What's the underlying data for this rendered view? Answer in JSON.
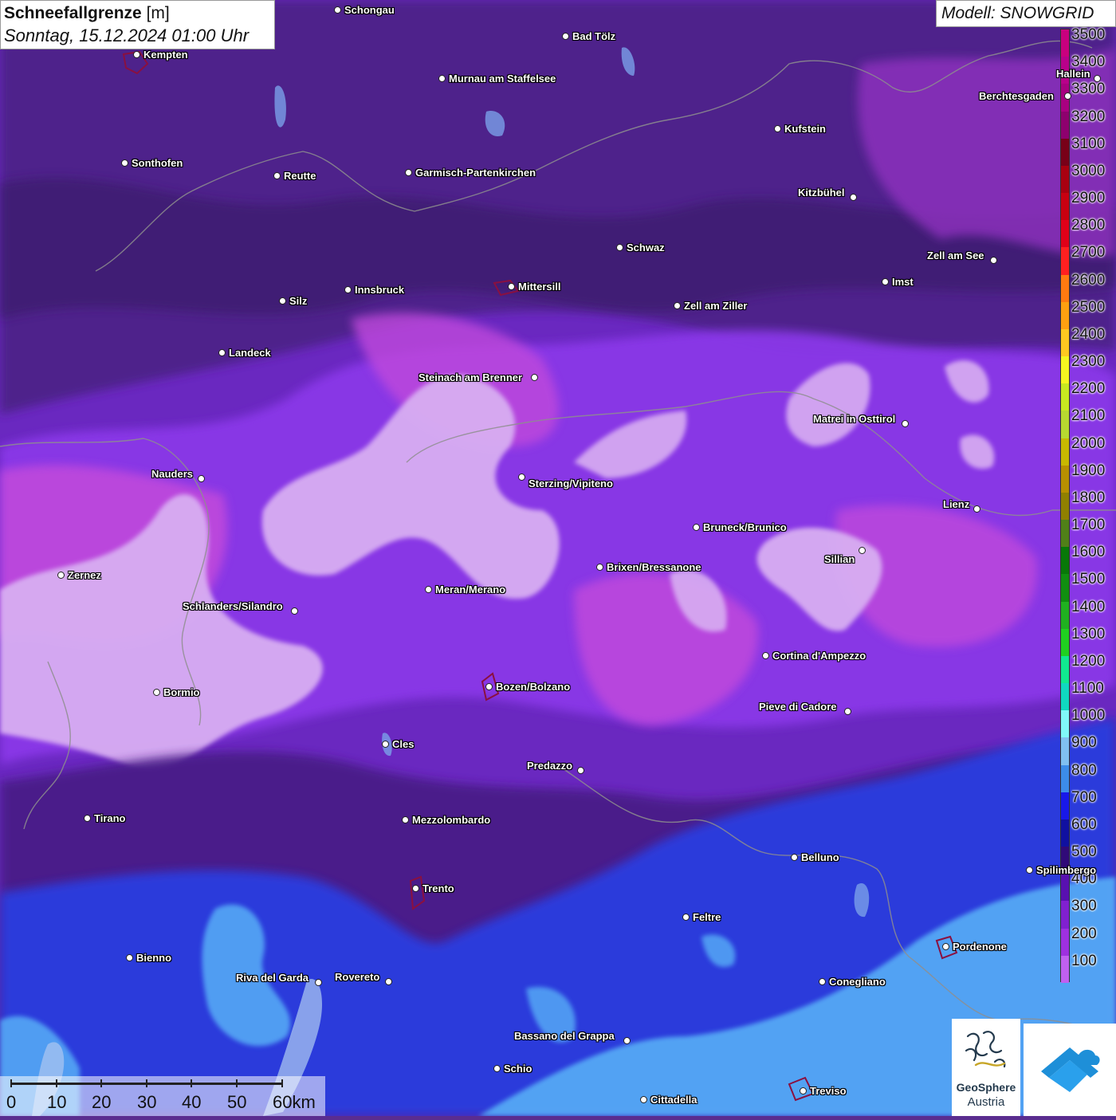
{
  "header": {
    "title": "Schneefallgrenze",
    "unit": "[m]",
    "datetime": "Sonntag, 15.12.2024 01:00 Uhr"
  },
  "model": {
    "label": "Modell: SNOWGRID"
  },
  "legend": {
    "values": [
      "3500",
      "3400",
      "3300",
      "3200",
      "3100",
      "3000",
      "2900",
      "2800",
      "2700",
      "2600",
      "2500",
      "2400",
      "2300",
      "2200",
      "2100",
      "2000",
      "1900",
      "1800",
      "1700",
      "1600",
      "1500",
      "1400",
      "1300",
      "1200",
      "1100",
      "1000",
      "900",
      "800",
      "700",
      "600",
      "500",
      "400",
      "300",
      "200",
      "100"
    ],
    "colors": [
      "#c8007e",
      "#b8008a",
      "#a80080",
      "#8e006e",
      "#780018",
      "#a80010",
      "#c80010",
      "#e00018",
      "#ff2020",
      "#ff7a10",
      "#ffa010",
      "#ffc820",
      "#f5f520",
      "#c8e820",
      "#b8d830",
      "#c8b800",
      "#b89000",
      "#908000",
      "#508018",
      "#087808",
      "#108e10",
      "#20b020",
      "#20d020",
      "#10e890",
      "#10d8c0",
      "#80f8f8",
      "#80c0f0",
      "#3c8ce8",
      "#1818e8",
      "#1010a0",
      "#300a78",
      "#5810b0",
      "#8020d0",
      "#9e30e0",
      "#c060f0"
    ]
  },
  "palette": {
    "light_blue": "#55a8f5",
    "blue": "#2a3ee0",
    "dark_purple": "#4a2080",
    "purple": "#6e28c8",
    "violet": "#9c3ff0",
    "magenta": "#c040e0",
    "pale": "#d8a8f0"
  },
  "places": [
    {
      "name": "Schongau"
    },
    {
      "name": "Bad Tölz"
    },
    {
      "name": "Kempten"
    },
    {
      "name": "Murnau am Staffelsee"
    },
    {
      "name": "Hallein"
    },
    {
      "name": "Berchtesgaden"
    },
    {
      "name": "Kufstein"
    },
    {
      "name": "Sonthofen"
    },
    {
      "name": "Reutte"
    },
    {
      "name": "Garmisch-Partenkirchen"
    },
    {
      "name": "Kitzbühel"
    },
    {
      "name": "Schwaz"
    },
    {
      "name": "Zell am See"
    },
    {
      "name": "Imst"
    },
    {
      "name": "Silz"
    },
    {
      "name": "Innsbruck"
    },
    {
      "name": "Mittersill"
    },
    {
      "name": "Zell am Ziller"
    },
    {
      "name": "Landeck"
    },
    {
      "name": "Steinach am Brenner"
    },
    {
      "name": "Matrei in Osttirol"
    },
    {
      "name": "Nauders"
    },
    {
      "name": "Sterzing/Vipiteno"
    },
    {
      "name": "Lienz"
    },
    {
      "name": "Bruneck/Brunico"
    },
    {
      "name": "Sillian"
    },
    {
      "name": "Zernez"
    },
    {
      "name": "Brixen/Bressanone"
    },
    {
      "name": "Meran/Merano"
    },
    {
      "name": "Schlanders/Silandro"
    },
    {
      "name": "Cortina d'Ampezzo"
    },
    {
      "name": "Bozen/Bolzano"
    },
    {
      "name": "Bormio"
    },
    {
      "name": "Pieve di Cadore"
    },
    {
      "name": "Cles"
    },
    {
      "name": "Predazzo"
    },
    {
      "name": "Tirano"
    },
    {
      "name": "Mezzolombardo"
    },
    {
      "name": "Belluno"
    },
    {
      "name": "Spilimbergo"
    },
    {
      "name": "Trento"
    },
    {
      "name": "Feltre"
    },
    {
      "name": "Pordenone"
    },
    {
      "name": "Bienno"
    },
    {
      "name": "Riva del Garda"
    },
    {
      "name": "Rovereto"
    },
    {
      "name": "Conegliano"
    },
    {
      "name": "Bassano del Grappa"
    },
    {
      "name": "Schio"
    },
    {
      "name": "Treviso"
    },
    {
      "name": "Cittadella"
    }
  ],
  "scalebar": {
    "labels": [
      "0",
      "10",
      "20",
      "30",
      "40",
      "50",
      "60km"
    ]
  },
  "logos": {
    "geosphere_line1": "GeoSphere",
    "geosphere_line2": "Austria"
  }
}
